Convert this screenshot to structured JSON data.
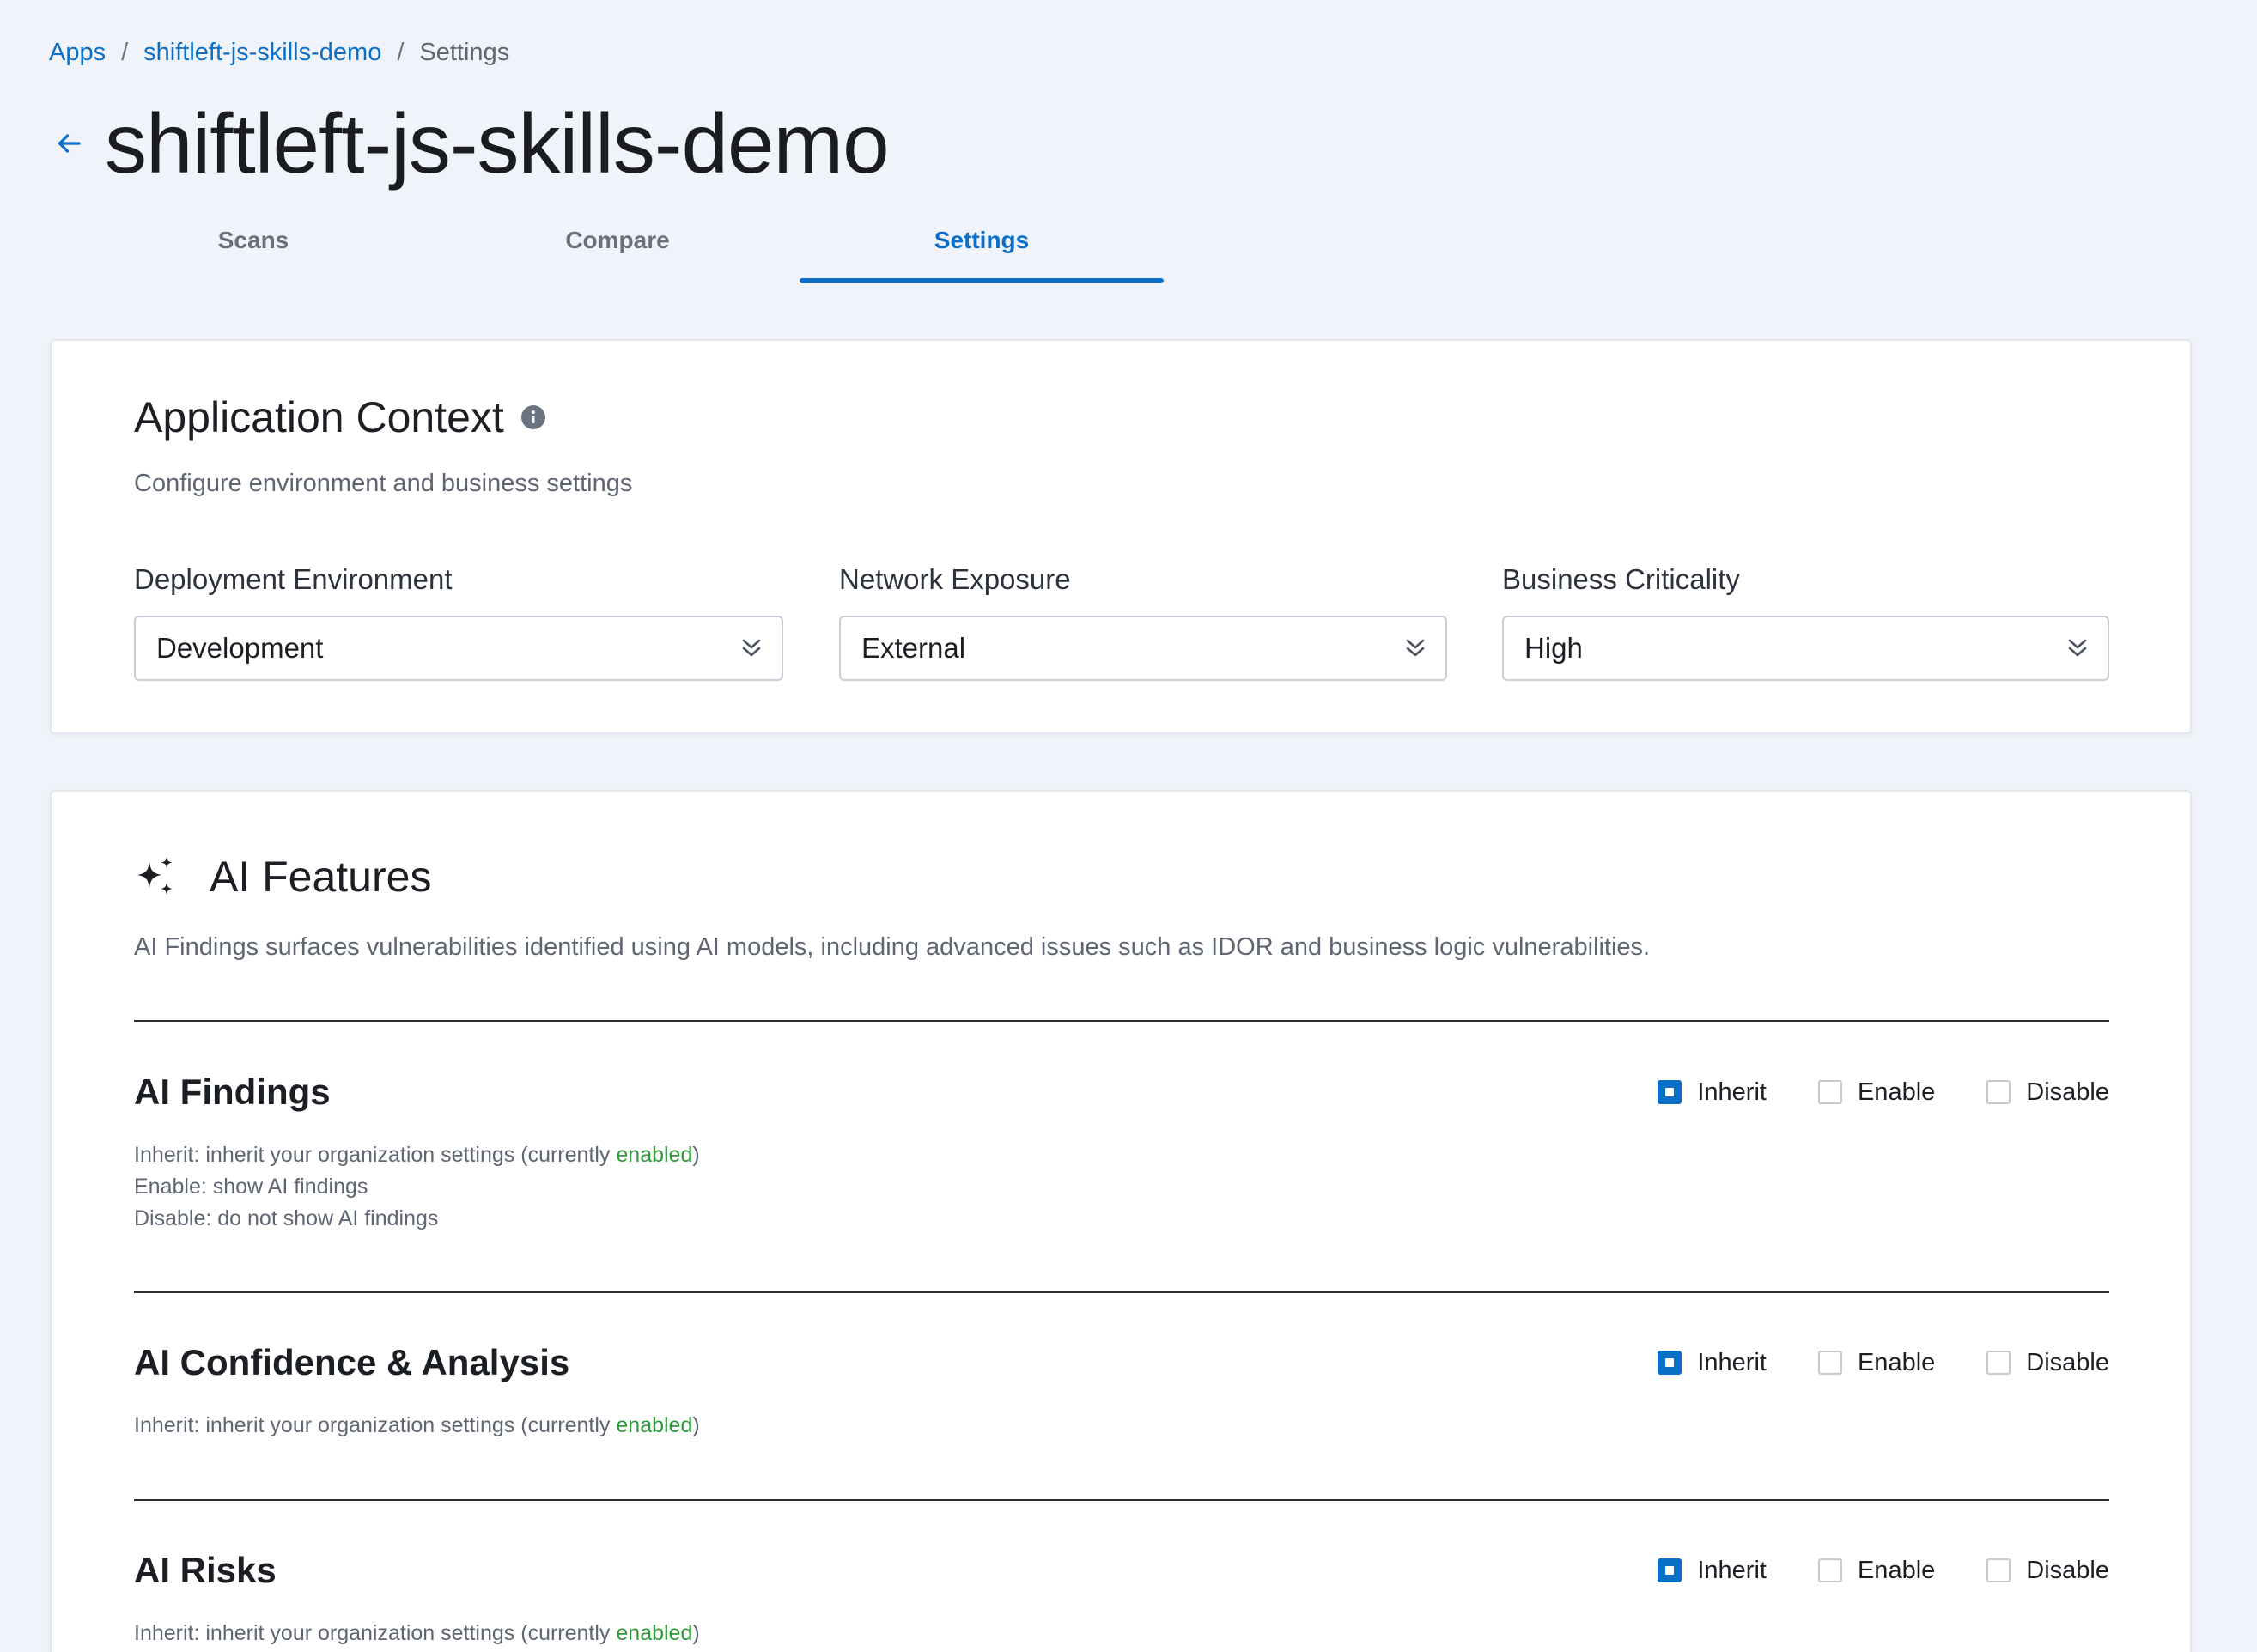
{
  "breadcrumb": {
    "apps": "Apps",
    "project": "shiftleft-js-skills-demo",
    "current": "Settings",
    "separator": "/"
  },
  "header": {
    "title": "shiftleft-js-skills-demo",
    "back_icon": "arrow-left-icon"
  },
  "tabs": [
    {
      "label": "Scans",
      "active": false
    },
    {
      "label": "Compare",
      "active": false
    },
    {
      "label": "Settings",
      "active": true
    }
  ],
  "context": {
    "title": "Application Context",
    "info_icon": "info-icon",
    "subtitle": "Configure environment and business settings",
    "fields": [
      {
        "label": "Deployment Environment",
        "value": "Development"
      },
      {
        "label": "Network Exposure",
        "value": "External"
      },
      {
        "label": "Business Criticality",
        "value": "High"
      }
    ]
  },
  "ai": {
    "icon": "sparkle-icon",
    "title": "AI Features",
    "subtitle": "AI Findings surfaces vulnerabilities identified using AI models, including advanced issues such as IDOR and business logic vulnerabilities.",
    "option_labels": {
      "inherit": "Inherit",
      "enable": "Enable",
      "disable": "Disable"
    },
    "settings": [
      {
        "title": "AI Findings",
        "selected": "inherit",
        "inherit_prefix": "Inherit: inherit your organization settings (currently ",
        "inherit_state": "enabled",
        "inherit_suffix": ")",
        "enable_desc": "Enable: show AI findings",
        "disable_desc": "Disable: do not show AI findings"
      },
      {
        "title": "AI Confidence & Analysis",
        "selected": "inherit",
        "inherit_prefix": "Inherit: inherit your organization settings (currently ",
        "inherit_state": "enabled",
        "inherit_suffix": ")"
      },
      {
        "title": "AI Risks",
        "selected": "inherit",
        "inherit_prefix": "Inherit: inherit your organization settings (currently ",
        "inherit_state": "enabled",
        "inherit_suffix": ")"
      }
    ]
  },
  "colors": {
    "accent": "#0b6fc8",
    "enabled_green": "#2e9a3a",
    "background": "#f1f3fa"
  }
}
